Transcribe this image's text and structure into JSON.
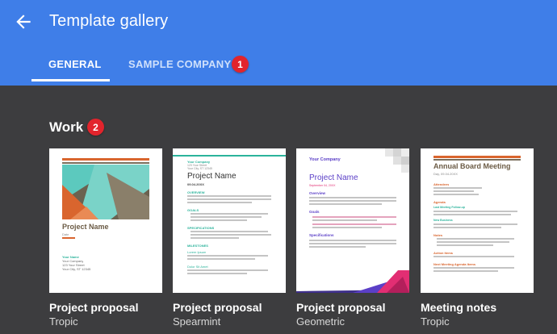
{
  "header": {
    "title": "Template gallery",
    "tabs": [
      {
        "label": "GENERAL",
        "active": true
      },
      {
        "label": "SAMPLE COMPANY",
        "active": false
      }
    ]
  },
  "badges": [
    "1",
    "2"
  ],
  "section": {
    "title": "Work"
  },
  "templates": [
    {
      "title": "Project proposal",
      "subtitle": "Tropic",
      "preview": {
        "heading": "Project Name",
        "date": "Date",
        "footer": [
          "Your Name",
          "Your Company",
          "123 Your Street",
          "Your City, ST 12345"
        ]
      }
    },
    {
      "title": "Project proposal",
      "subtitle": "Spearmint",
      "preview": {
        "company": "Your Company",
        "company_lines": [
          "123 Your Street",
          "Your City, ST 12345"
        ],
        "heading": "Project Name",
        "date": "09.04.20XX",
        "sections": [
          "OVERVIEW",
          "GOALS",
          "SPECIFICATIONS",
          "MILESTONES"
        ],
        "milestones": [
          "Lorem Ipsum",
          "Dolor Sit Amet"
        ]
      }
    },
    {
      "title": "Project proposal",
      "subtitle": "Geometric",
      "preview": {
        "company": "Your Company",
        "heading": "Project Name",
        "date": "September 04, 20XX",
        "sections": [
          "Overview",
          "Goals",
          "Specifications"
        ]
      }
    },
    {
      "title": "Meeting notes",
      "subtitle": "Tropic",
      "preview": {
        "heading": "Annual Board Meeting",
        "date": "Day, 09.04.20XX",
        "sections": [
          "Attendees",
          "Agenda",
          "Last Meeting Follow-up",
          "New Business",
          "Notes",
          "Action Items",
          "Next Meeting Agenda Items"
        ]
      }
    }
  ],
  "colors": {
    "appbar": "#3f7ee8",
    "background": "#3d3d3f",
    "badge": "#e2242c",
    "tropic_accent": "#d9652e",
    "spearmint_accent": "#2bb39b",
    "geometric_accent": "#5b3fc7",
    "geometric_pink": "#e22e73"
  },
  "icons": {
    "back": "arrow-left-icon"
  }
}
